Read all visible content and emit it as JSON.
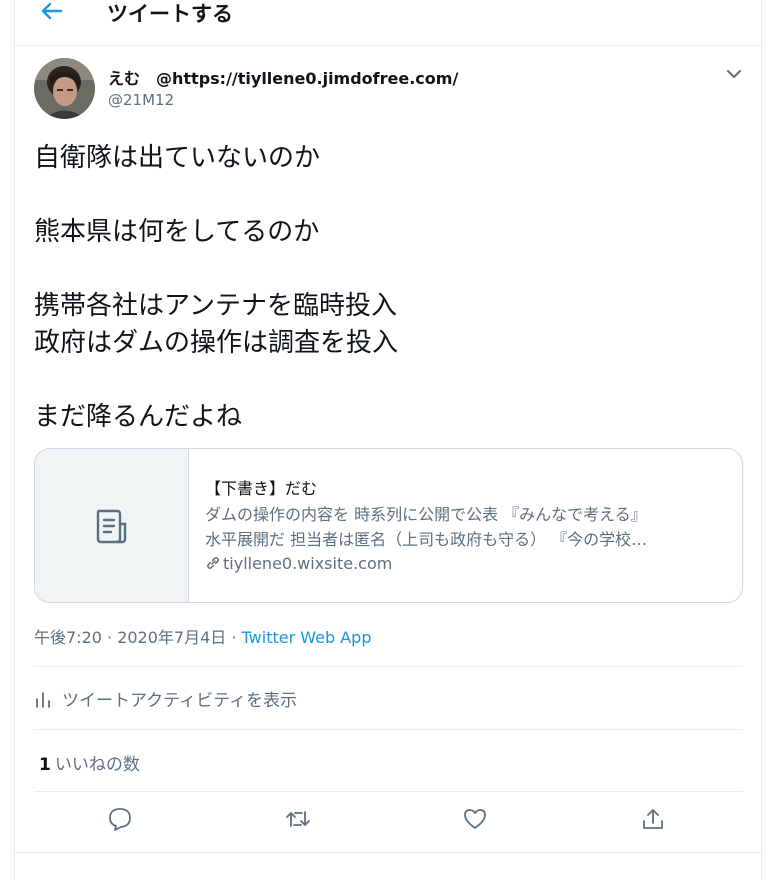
{
  "header": {
    "title": "ツイートする"
  },
  "tweet": {
    "author_name": "えむ　@https://tiyllene0.jimdofree.com/",
    "author_handle": "@21M12",
    "lines": [
      "自衛隊は出ていないのか",
      "",
      "熊本県は何をしてるのか",
      "",
      "携帯各社はアンテナを臨時投入",
      "政府はダムの操作は調査を投入",
      "",
      "まだ降るんだよね"
    ],
    "card": {
      "title": "【下書き】だむ",
      "desc_line1": "ダムの操作の内容を 時系列に公開で公表 『みんなで考える』",
      "desc_line2": "水平展開だ 担当者は匿名（上司も政府も守る） 『今の学校…",
      "domain": "tiyllene0.wixsite.com"
    },
    "timestamp": "午後7:20 · 2020年7月4日 · ",
    "source": "Twitter Web App",
    "activity_label": "ツイートアクティビティを表示",
    "likes_count": "1",
    "likes_label": "いいねの数"
  },
  "colors": {
    "accent": "#1b95e0",
    "muted": "#5b7083",
    "border": "#e6ecf0"
  }
}
